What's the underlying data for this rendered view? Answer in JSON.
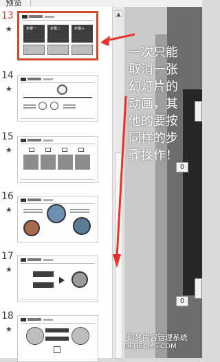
{
  "tab": {
    "label": "预览"
  },
  "slides": [
    {
      "number": "13",
      "star": "★",
      "selected": true
    },
    {
      "number": "14",
      "star": "★",
      "selected": false
    },
    {
      "number": "15",
      "star": "★",
      "selected": false
    },
    {
      "number": "16",
      "star": "★",
      "selected": false
    },
    {
      "number": "17",
      "star": "★",
      "selected": false
    },
    {
      "number": "18",
      "star": "★",
      "selected": false
    }
  ],
  "thumbnails": {
    "slide13": {
      "box_labels": [
        "步骤一",
        "步骤二",
        "步骤三"
      ]
    }
  },
  "canvas": {
    "counters": [
      "0",
      "0"
    ]
  },
  "annotation": {
    "text": "一次只能取消一张幻灯片的动画，其他的要按同样的步骤操作！"
  },
  "watermark": {
    "line1": "织梦内容管理系统",
    "line2": "DEDECMS.COM"
  },
  "colors": {
    "selection": "#d24726",
    "annotation_arrow": "#e8322a"
  },
  "scrollbar": {
    "up_icon": "scroll-up-arrow-icon"
  }
}
